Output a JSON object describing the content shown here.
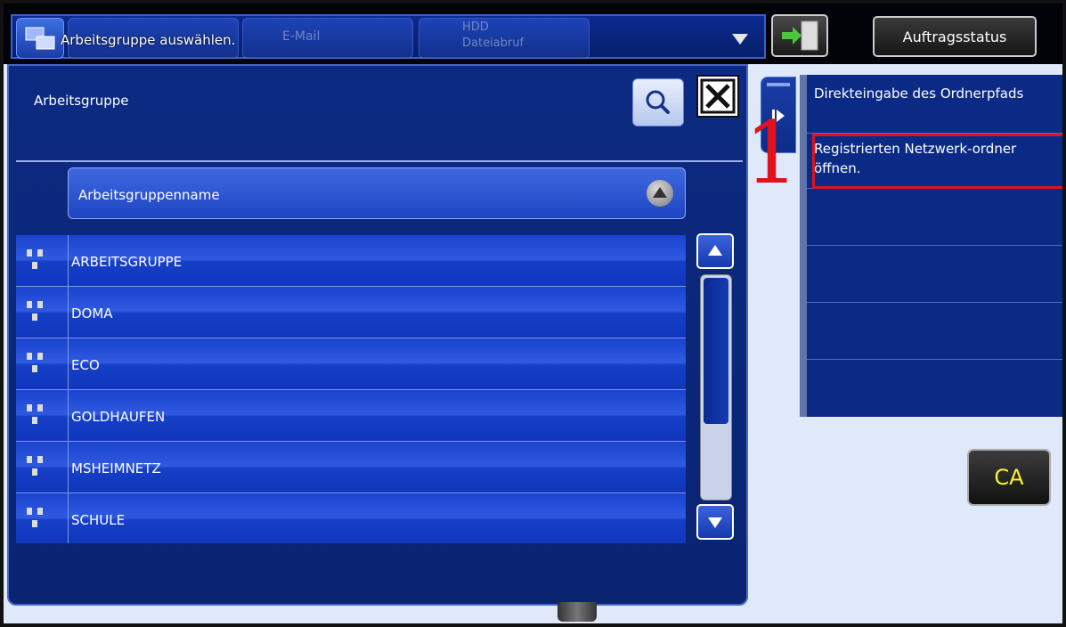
{
  "header": {
    "title": "Arbeitsgruppe auswählen.",
    "ghost_tab_email": "E-Mail",
    "ghost_tab_hdd_line1": "HDD",
    "ghost_tab_hdd_line2": "Dateiabruf",
    "job_status_label": "Auftragsstatus"
  },
  "dialog": {
    "title": "Arbeitsgruppe",
    "column_header": "Arbeitsgruppenname",
    "workgroups": [
      "ARBEITSGRUPPE",
      "DOMA",
      "ECO",
      "GOLDHAUFEN",
      "MSHEIMNETZ",
      "SCHULE"
    ]
  },
  "side_panel": {
    "items": [
      "Direkteingabe des Ordnerpfads",
      "Registrierten Netzwerk-ordner öffnen."
    ]
  },
  "annotation": {
    "step_number": "1",
    "color": "#e0121c"
  },
  "ca_button_label": "CA",
  "colors": {
    "accent_blue": "#1d45c2",
    "panel_blue": "#0a2a86"
  }
}
